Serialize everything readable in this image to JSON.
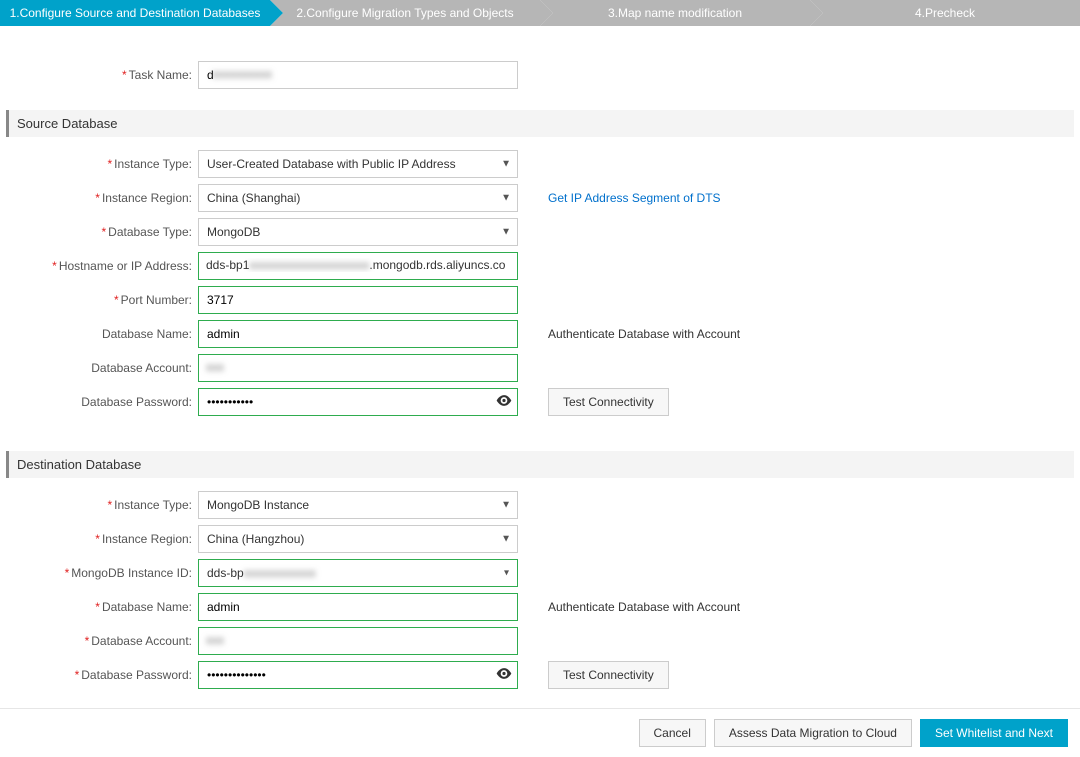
{
  "steps": [
    "1.Configure Source and Destination Databases",
    "2.Configure Migration Types and Objects",
    "3.Map name modification",
    "4.Precheck"
  ],
  "taskName": {
    "label": "Task Name:",
    "value": "d"
  },
  "sourceTitle": "Source Database",
  "destTitle": "Destination Database",
  "source": {
    "instanceType": {
      "label": "Instance Type:",
      "value": "User-Created Database with Public IP Address"
    },
    "instanceRegion": {
      "label": "Instance Region:",
      "value": "China (Shanghai)",
      "extraLink": "Get IP Address Segment of DTS"
    },
    "databaseType": {
      "label": "Database Type:",
      "value": "MongoDB"
    },
    "hostip": {
      "label": "Hostname or IP Address:",
      "prefix": "dds-bp1",
      "suffix": ".mongodb.rds.aliyuncs.co"
    },
    "port": {
      "label": "Port Number:",
      "value": "3717"
    },
    "dbName": {
      "label": "Database Name:",
      "value": "admin",
      "hint": "Authenticate Database with Account"
    },
    "dbAccount": {
      "label": "Database Account:",
      "value": ""
    },
    "dbPassword": {
      "label": "Database Password:",
      "dots": "•••••••••••"
    },
    "testBtn": "Test Connectivity"
  },
  "dest": {
    "instanceType": {
      "label": "Instance Type:",
      "value": "MongoDB Instance"
    },
    "instanceRegion": {
      "label": "Instance Region:",
      "value": "China (Hangzhou)"
    },
    "mongoId": {
      "label": "MongoDB Instance ID:",
      "value": "dds-bp"
    },
    "dbName": {
      "label": "Database Name:",
      "value": "admin",
      "hint": "Authenticate Database with Account"
    },
    "dbAccount": {
      "label": "Database Account:",
      "value": ""
    },
    "dbPassword": {
      "label": "Database Password:",
      "dots": "••••••••••••••"
    },
    "testBtn": "Test Connectivity"
  },
  "footer": {
    "cancel": "Cancel",
    "assess": "Assess Data Migration to Cloud",
    "next": "Set Whitelist and Next"
  }
}
